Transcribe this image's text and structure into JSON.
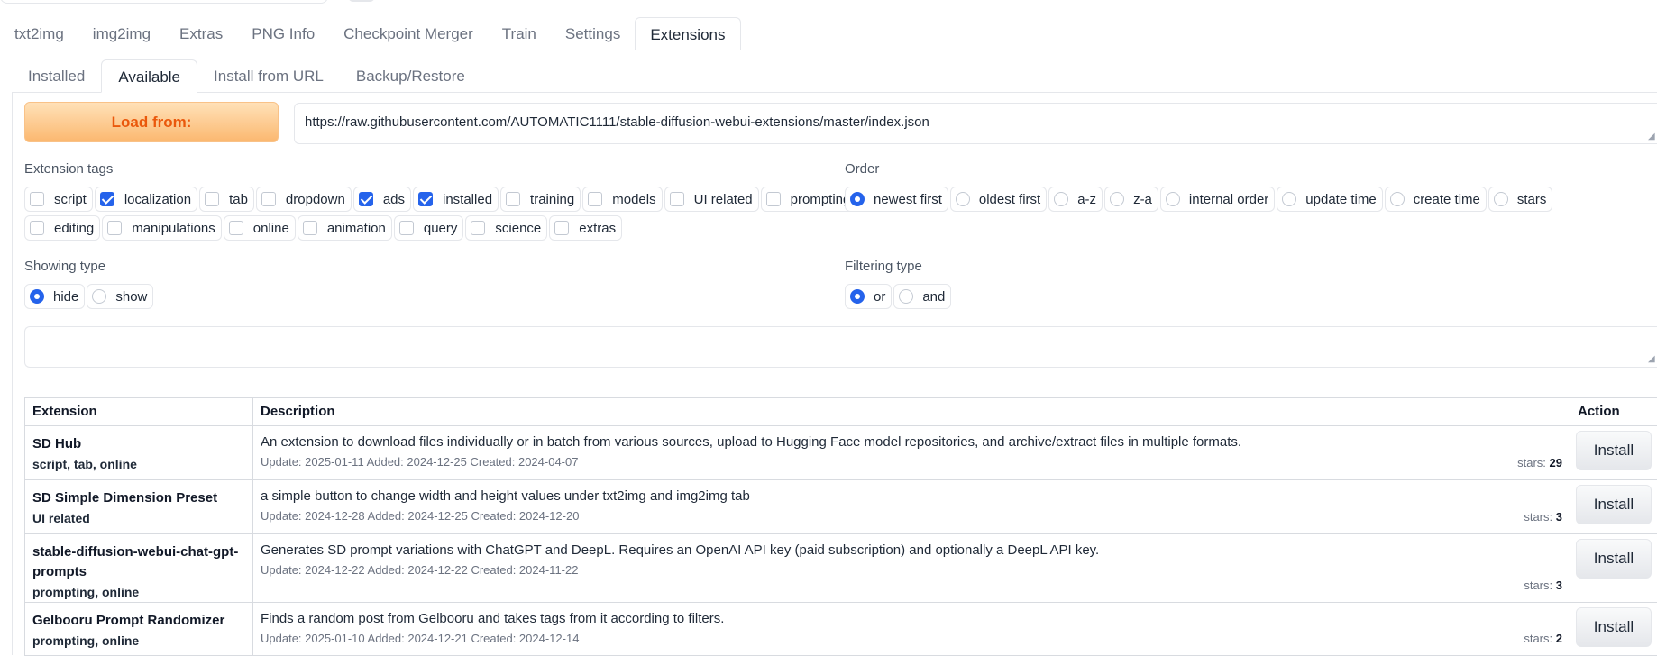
{
  "main_tabs": [
    "txt2img",
    "img2img",
    "Extras",
    "PNG Info",
    "Checkpoint Merger",
    "Train",
    "Settings",
    "Extensions"
  ],
  "sub_tabs": [
    "Installed",
    "Available",
    "Install from URL",
    "Backup/Restore"
  ],
  "load_from": {
    "button_label": "Load from:",
    "url": "https://raw.githubusercontent.com/AUTOMATIC1111/stable-diffusion-webui-extensions/master/index.json"
  },
  "extension_tags": {
    "label": "Extension tags",
    "tags": [
      {
        "label": "script",
        "checked": false
      },
      {
        "label": "localization",
        "checked": true
      },
      {
        "label": "tab",
        "checked": false
      },
      {
        "label": "dropdown",
        "checked": false
      },
      {
        "label": "ads",
        "checked": true
      },
      {
        "label": "installed",
        "checked": true
      },
      {
        "label": "training",
        "checked": false
      },
      {
        "label": "models",
        "checked": false
      },
      {
        "label": "UI related",
        "checked": false
      },
      {
        "label": "prompting",
        "checked": false
      },
      {
        "label": "editing",
        "checked": false
      },
      {
        "label": "manipulations",
        "checked": false
      },
      {
        "label": "online",
        "checked": false
      },
      {
        "label": "animation",
        "checked": false
      },
      {
        "label": "query",
        "checked": false
      },
      {
        "label": "science",
        "checked": false
      },
      {
        "label": "extras",
        "checked": false
      }
    ]
  },
  "order": {
    "label": "Order",
    "options": [
      {
        "label": "newest first",
        "selected": true
      },
      {
        "label": "oldest first",
        "selected": false
      },
      {
        "label": "a-z",
        "selected": false
      },
      {
        "label": "z-a",
        "selected": false
      },
      {
        "label": "internal order",
        "selected": false
      },
      {
        "label": "update time",
        "selected": false
      },
      {
        "label": "create time",
        "selected": false
      },
      {
        "label": "stars",
        "selected": false
      }
    ]
  },
  "showing_type": {
    "label": "Showing type",
    "options": [
      {
        "label": "hide",
        "selected": true
      },
      {
        "label": "show",
        "selected": false
      }
    ]
  },
  "filtering_type": {
    "label": "Filtering type",
    "options": [
      {
        "label": "or",
        "selected": true
      },
      {
        "label": "and",
        "selected": false
      }
    ]
  },
  "table": {
    "headers": [
      "Extension",
      "Description",
      "Action"
    ],
    "rows": [
      {
        "name": "SD Hub",
        "tags": "script, tab, online",
        "description": "An extension to download files individually or in batch from various sources, upload to Hugging Face model repositories, and archive/extract files in multiple formats.",
        "dates": "Update: 2025-01-11 Added: 2024-12-25 Created: 2024-04-07",
        "stars_label": "stars:",
        "stars": "29",
        "action": "Install"
      },
      {
        "name": "SD Simple Dimension Preset",
        "tags": "UI related",
        "description": "a simple button to change width and height values under txt2img and img2img tab",
        "dates": "Update: 2024-12-28 Added: 2024-12-25 Created: 2024-12-20",
        "stars_label": "stars:",
        "stars": "3",
        "action": "Install"
      },
      {
        "name": "stable-diffusion-webui-chat-gpt-prompts",
        "tags": "prompting, online",
        "description": "Generates SD prompt variations with ChatGPT and DeepL. Requires an OpenAI API key (paid subscription) and optionally a DeepL API key.",
        "dates": "Update: 2024-12-22 Added: 2024-12-22 Created: 2024-11-22",
        "stars_label": "stars:",
        "stars": "3",
        "action": "Install"
      },
      {
        "name": "Gelbooru Prompt Randomizer",
        "tags": "prompting, online",
        "description": "Finds a random post from Gelbooru and takes tags from it according to filters.",
        "dates": "Update: 2025-01-10 Added: 2024-12-21 Created: 2024-12-14",
        "stars_label": "stars:",
        "stars": "2",
        "action": "Install"
      }
    ]
  }
}
